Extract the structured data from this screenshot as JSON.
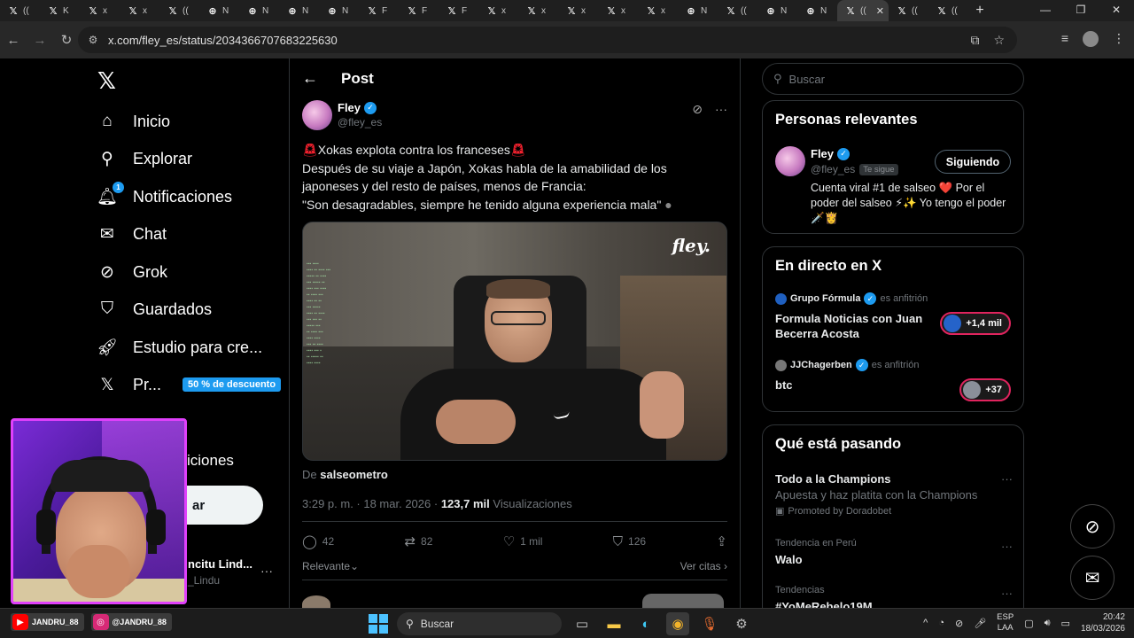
{
  "browser": {
    "tabs": [
      {
        "icon": "X",
        "label": "(("
      },
      {
        "icon": "X",
        "label": "K"
      },
      {
        "icon": "X",
        "label": "x"
      },
      {
        "icon": "X",
        "label": "x"
      },
      {
        "icon": "X",
        "label": "(("
      },
      {
        "icon": "G",
        "label": "N"
      },
      {
        "icon": "G",
        "label": "N"
      },
      {
        "icon": "G",
        "label": "N"
      },
      {
        "icon": "G",
        "label": "N"
      },
      {
        "icon": "X",
        "label": "F"
      },
      {
        "icon": "X",
        "label": "F"
      },
      {
        "icon": "X",
        "label": "F"
      },
      {
        "icon": "X",
        "label": "x"
      },
      {
        "icon": "X",
        "label": "x"
      },
      {
        "icon": "X",
        "label": "x"
      },
      {
        "icon": "X",
        "label": "x"
      },
      {
        "icon": "X",
        "label": "x"
      },
      {
        "icon": "G",
        "label": "N"
      },
      {
        "icon": "X",
        "label": "(("
      },
      {
        "icon": "G",
        "label": "N"
      },
      {
        "icon": "G",
        "label": "N"
      }
    ],
    "active_tab": {
      "icon": "X",
      "label": "(("
    },
    "after_tabs": [
      {
        "icon": "X",
        "label": "(("
      },
      {
        "icon": "X",
        "label": "(("
      }
    ],
    "url": "x.com/fley_es/status/2034366707683225630"
  },
  "nav": {
    "home": "Inicio",
    "explore": "Explorar",
    "notifications": "Notificaciones",
    "notifications_badge": "1",
    "chat": "Chat",
    "grok": "Grok",
    "bookmarks": "Guardados",
    "creator_studio": "Estudio para cre...",
    "premium": "Pr...",
    "premium_badge": "50 % de descuento",
    "partial_item": "iciones",
    "post_button": "ar"
  },
  "account": {
    "name": "ncitu Lind...",
    "handle": "_Lindu"
  },
  "post": {
    "header": "Post",
    "author_name": "Fley",
    "author_handle": "@fley_es",
    "text_line1": "Xokas explota contra los franceses",
    "text_line2": "Después de su viaje a Japón, Xokas habla de la amabilidad de los",
    "text_line3": "japoneses y del resto de países, menos de Francia:",
    "text_line4": "\"Son desagradables, siempre he tenido alguna experiencia mala\"",
    "media_logo": "fley.",
    "source_prefix": "De",
    "source_name": "salseometro",
    "time": "3:29 p. m. · 18 mar. 2026 ·",
    "views_count": "123,7 mil",
    "views_label": "Visualizaciones",
    "replies": "42",
    "reposts": "82",
    "likes": "1 mil",
    "bookmarks": "126",
    "sort": "Relevante",
    "quotes": "Ver citas"
  },
  "right": {
    "search_placeholder": "Buscar",
    "relevant_title": "Personas relevantes",
    "rel_name": "Fley",
    "rel_handle": "@fley_es",
    "rel_follows_you": "Te sigue",
    "rel_following": "Siguiendo",
    "rel_bio": "Cuenta viral #1 de salseo ❤️ Por el poder del salseo ⚡✨ Yo tengo el poder 🗡️👸",
    "live_title": "En directo en X",
    "live": [
      {
        "host": "Grupo Fórmula",
        "host_suffix": "es anfitrión",
        "title": "Formula Noticias con Juan Becerra Acosta",
        "count": "+1,4 mil"
      },
      {
        "host": "JJChagerben",
        "host_suffix": "es anfitrión",
        "title": "btc",
        "count": "+37"
      }
    ],
    "trending_title": "Qué está pasando",
    "trends": [
      {
        "title": "Todo a la Champions",
        "sub": "Apuesta y haz platita con la Champions",
        "promo": "Promoted by Doradobet"
      },
      {
        "ctx": "Tendencia en Perú",
        "title": "Walo"
      },
      {
        "ctx": "Tendencias",
        "title": "#YoMeRebelo19M"
      }
    ]
  },
  "taskbar": {
    "youtube_handle": "JANDRU_88",
    "instagram_handle": "@JANDRU_88",
    "search": "Buscar",
    "lang1": "ESP",
    "lang2": "LAA",
    "time": "20:42",
    "date": "18/03/2026"
  }
}
